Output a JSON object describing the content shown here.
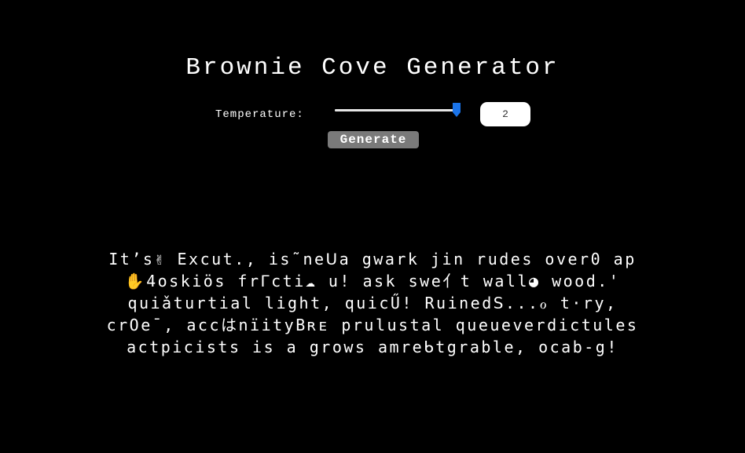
{
  "page": {
    "title": "Brownie Cove Generator"
  },
  "controls": {
    "temperature_label": "Temperature:",
    "temperature_value": "2",
    "slider_level_fraction": 0.97,
    "generate_label": "Generate"
  },
  "colors": {
    "background": "#000000",
    "text": "#ffffff",
    "slider_thumb": "#1a73e8",
    "button_bg": "#7a7a7a"
  },
  "output": {
    "lines": [
      "It’s✌ Excut., is˜neꓴa gwark jin rudes over0 ap",
      "✋4oskiös frᒥcti☁ u! ask swe亻t wall◕ wood.'",
      "quiǎturtial light, quicŰ! Ruinedꓢ...ℴ t·ry,",
      "crOe¯, accはnïityBʀᴇ prulustal queueverdictules",
      "actpicists is a grows amreᑲtgrable, ocab-g!"
    ]
  }
}
